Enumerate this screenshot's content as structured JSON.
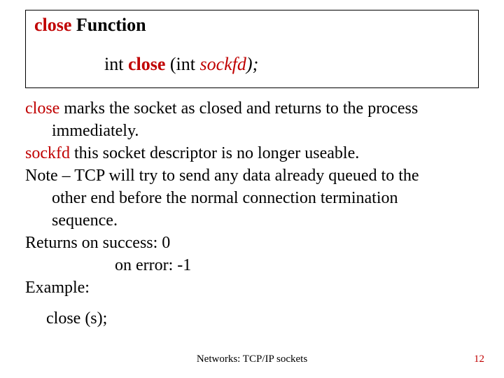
{
  "title": {
    "keyword": "close",
    "rest": "  Function"
  },
  "signature": {
    "ret_type": "int  ",
    "func_name": "close",
    "open": "    (int  ",
    "param": "sockfd",
    "close_paren": ");"
  },
  "desc": {
    "l1a": "close",
    "l1b": " marks the socket as closed and returns to the process",
    "l1c": "immediately.",
    "l2a": "sockfd",
    "l2b": "  this socket descriptor is no longer useable.",
    "l3a": "Note – TCP will try to send any data already queued to the",
    "l3b": "other end before the normal connection termination",
    "l3c": "sequence.",
    "l4a": "Returns on success:     0",
    "l4b": "on error:      -1",
    "l5": "Example:",
    "code": "close (s);"
  },
  "footer": "Networks: TCP/IP sockets",
  "pagenum": "12"
}
